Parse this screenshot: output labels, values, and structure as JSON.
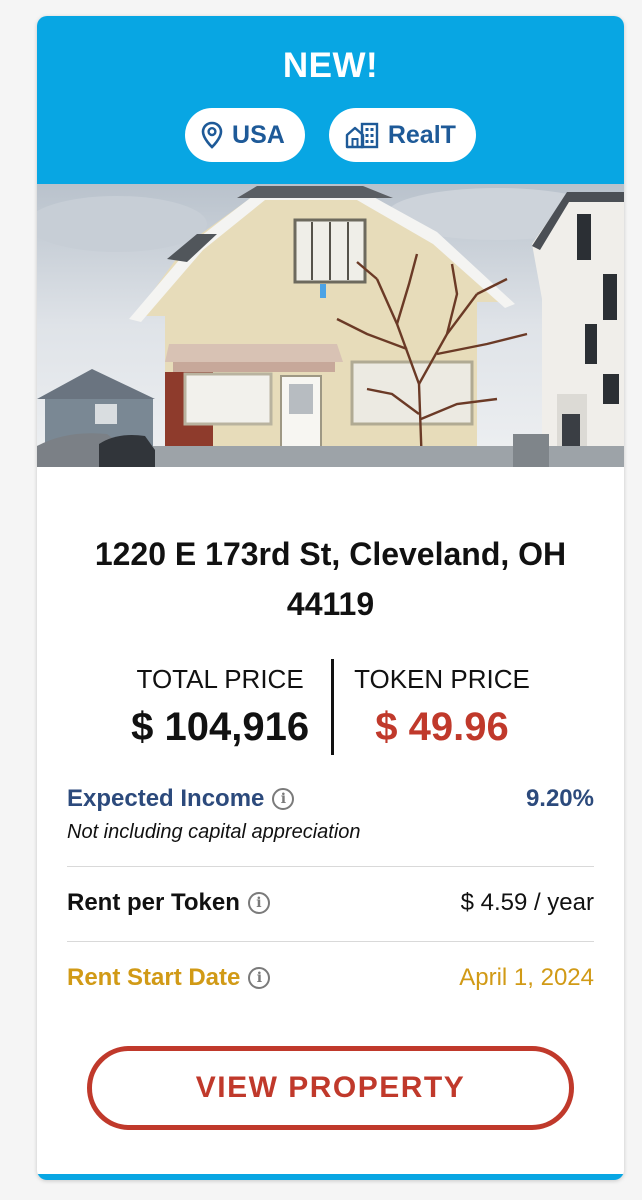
{
  "banner": {
    "title": "NEW!",
    "location_tag": "USA",
    "location_icon": "map-pin-icon",
    "provider_tag": "RealT",
    "provider_icon": "buildings-icon",
    "color": "#08a6e3"
  },
  "property": {
    "address": "1220 E 173rd St, Cleveland, OH 44119",
    "photo": "house-photo"
  },
  "prices": {
    "total_label": "TOTAL PRICE",
    "total_value": "$ 104,916",
    "token_label": "TOKEN PRICE",
    "token_value": "$ 49.96",
    "token_color": "#c0392b"
  },
  "details": {
    "expected_income": {
      "label": "Expected Income",
      "note": "Not including capital appreciation",
      "value": "9.20%",
      "color": "#2c4a7c"
    },
    "rent_per_token": {
      "label": "Rent per Token",
      "value": "$ 4.59 / year"
    },
    "rent_start_date": {
      "label": "Rent Start Date",
      "value": "April 1, 2024",
      "color": "#d19a16"
    }
  },
  "actions": {
    "view_label": "VIEW PROPERTY"
  }
}
